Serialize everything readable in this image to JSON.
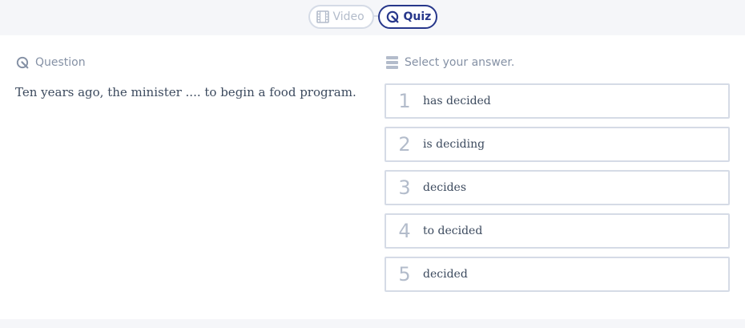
{
  "tabs": {
    "video": {
      "label": "Video",
      "icon": "film-icon"
    },
    "quiz": {
      "label": "Quiz",
      "icon": "quiz-icon"
    }
  },
  "question": {
    "header": "Question",
    "text": "Ten years ago, the minister .... to begin a food program."
  },
  "answers": {
    "header": "Select your answer.",
    "options": [
      {
        "num": "1",
        "label": "has decided"
      },
      {
        "num": "2",
        "label": "is deciding"
      },
      {
        "num": "3",
        "label": "decides"
      },
      {
        "num": "4",
        "label": "to decided"
      },
      {
        "num": "5",
        "label": "decided"
      }
    ]
  },
  "colors": {
    "accent": "#27378b",
    "muted": "#b3bccb",
    "border": "#d5dbe6",
    "text": "#3c4a5e",
    "bar": "#f5f6f9"
  }
}
